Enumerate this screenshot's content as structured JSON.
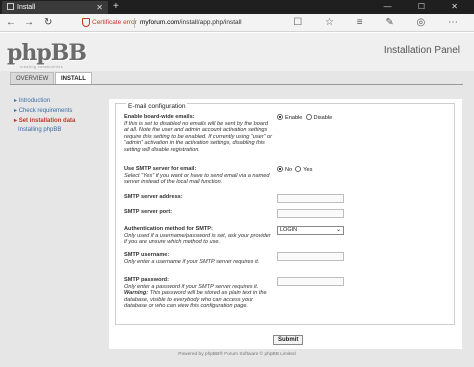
{
  "browser": {
    "tab_title": "Install",
    "new_tab": "+",
    "window_controls": "— ☐ ✕",
    "cert_error": "Certificate error",
    "url_host": "myforum.com",
    "url_path": "/install/app.php/install",
    "back": "←",
    "forward": "→",
    "refresh": "↻",
    "right_icons": "☐ ☆ ≡ ✎ ◎ ⋯"
  },
  "header": {
    "logo": "phpBB",
    "logo_sub": "creating communities",
    "panel_title": "Installation Panel"
  },
  "tabs": [
    "OVERVIEW",
    "INSTALL"
  ],
  "sidebar": {
    "items": [
      "Introduction",
      "Check requirements",
      "Set installation data",
      "Installing phpBB"
    ]
  },
  "form": {
    "legend": "E-mail configuration",
    "fields": {
      "board_emails": {
        "title": "Enable board-wide emails:",
        "desc": "If this is set to disabled no emails will be sent by the board at all. Note the user and admin account activation settings require this setting to be enabled. If currently using “user” or “admin” activation in the activation settings, disabling this setting will disable registration.",
        "opt_on": "Enable",
        "opt_off": "Disable"
      },
      "use_smtp": {
        "title": "Use SMTP server for email:",
        "desc": "Select “Yes” if you want or have to send email via a named server instead of the local mail function.",
        "opt_no": "No",
        "opt_yes": "Yes"
      },
      "smtp_address": {
        "title": "SMTP server address:"
      },
      "smtp_port": {
        "title": "SMTP server port:"
      },
      "auth_method": {
        "title": "Authentication method for SMTP:",
        "desc": "Only used if a username/password is set, ask your provider if you are unsure which method to use.",
        "value": "LOGIN"
      },
      "smtp_username": {
        "title": "SMTP username:",
        "desc": "Only enter a username if your SMTP server requires it."
      },
      "smtp_password": {
        "title": "SMTP password:",
        "desc": "Only enter a password if your SMTP server requires it.",
        "warning_label": "Warning:",
        "warning": "This password will be stored as plain text in the database, visible to everybody who can access your database or who can view this configuration page."
      }
    },
    "submit": "Submit"
  },
  "footer": "Powered by phpBB® Forum Software © phpBB Limited"
}
